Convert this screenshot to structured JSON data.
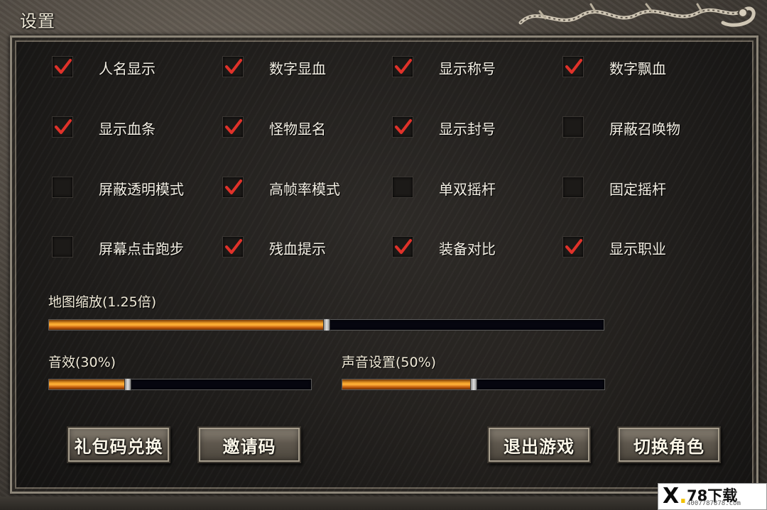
{
  "window": {
    "title": "设置"
  },
  "options": [
    {
      "label": "人名显示",
      "checked": true
    },
    {
      "label": "数字显血",
      "checked": true
    },
    {
      "label": "显示称号",
      "checked": true
    },
    {
      "label": "数字飘血",
      "checked": true
    },
    {
      "label": "显示血条",
      "checked": true
    },
    {
      "label": "怪物显名",
      "checked": true
    },
    {
      "label": "显示封号",
      "checked": true
    },
    {
      "label": "屏蔽召唤物",
      "checked": false
    },
    {
      "label": "屏蔽透明模式",
      "checked": false
    },
    {
      "label": "高帧率模式",
      "checked": true
    },
    {
      "label": "单双摇杆",
      "checked": false
    },
    {
      "label": "固定摇杆",
      "checked": false
    },
    {
      "label": "屏幕点击跑步",
      "checked": false
    },
    {
      "label": "残血提示",
      "checked": true
    },
    {
      "label": "装备对比",
      "checked": true
    },
    {
      "label": "显示职业",
      "checked": true
    }
  ],
  "sliders": {
    "map_zoom": {
      "label": "地图缩放(1.25倍)",
      "value": 0.5
    },
    "sound_effects": {
      "label": "音效(30%)",
      "value": 0.3
    },
    "sound_settings": {
      "label": "声音设置(50%)",
      "value": 0.5
    }
  },
  "buttons": {
    "gift_code": "礼包码兑换",
    "invite_code": "邀请码",
    "exit_game": "退出游戏",
    "switch_role": "切换角色"
  },
  "watermark": {
    "brand": "78下载",
    "url": "4007787878.com"
  },
  "colors": {
    "check": "#e0322a",
    "slider_fill": "#f2a12a",
    "text": "#f3efe4"
  }
}
